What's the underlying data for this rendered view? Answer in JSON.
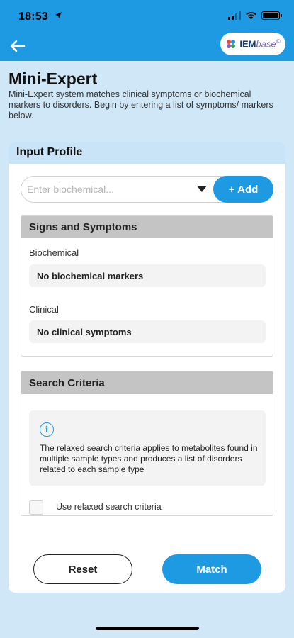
{
  "status_bar": {
    "time": "18:53",
    "location_icon": "location-arrow-icon"
  },
  "app_bar": {
    "back_icon": "back-arrow-icon",
    "logo_text_a": "IEM",
    "logo_text_b": "base",
    "logo_sup": "©"
  },
  "page": {
    "title": "Mini-Expert",
    "description": "Mini-Expert system matches clinical symptoms or biochemical markers to disorders. Begin by entering a list of symptoms/ markers below."
  },
  "input_profile": {
    "header": "Input Profile",
    "search_placeholder": "Enter biochemical...",
    "add_label": "+ Add"
  },
  "signs_symptoms": {
    "header": "Signs and Symptoms",
    "biochemical_label": "Biochemical",
    "biochemical_empty": "No biochemical markers",
    "clinical_label": "Clinical",
    "clinical_empty": "No clinical symptoms"
  },
  "search_criteria": {
    "header": "Search Criteria",
    "info_icon_glyph": "i",
    "info_text": "The relaxed search criteria applies to metabolites found in multiple sample types and produces a list of disorders related to each sample type",
    "checkbox_label": "Use relaxed search criteria",
    "checkbox_checked": false
  },
  "actions": {
    "reset_label": "Reset",
    "match_label": "Match"
  },
  "colors": {
    "accent": "#1e9ae3",
    "card_header_bg": "#c9e4f7",
    "section_header_bg": "#c4c4c4",
    "page_bg": "#d0e7f8"
  }
}
